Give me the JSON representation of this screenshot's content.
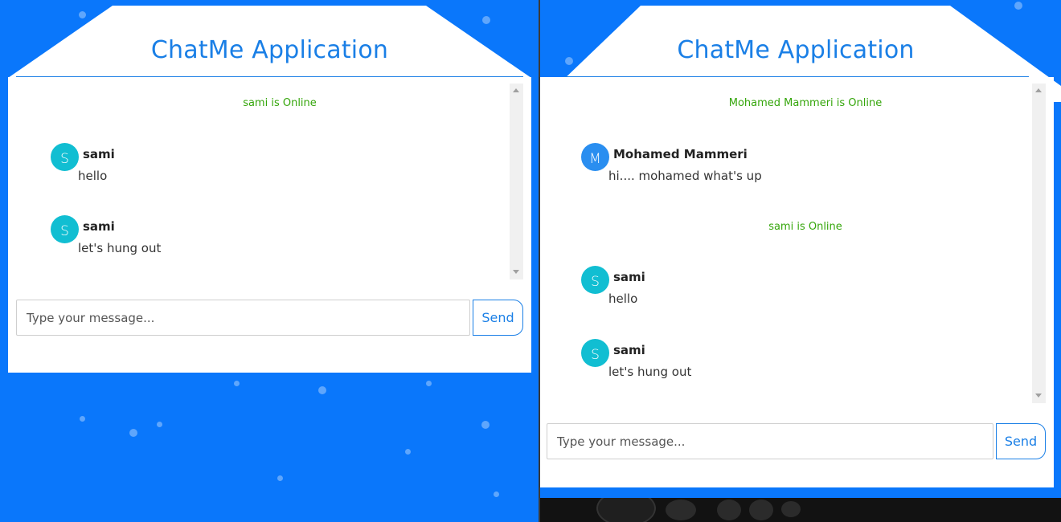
{
  "panes": [
    {
      "title": "ChatMe Application",
      "messages": [
        {
          "type": "status",
          "text": "sami is Online"
        },
        {
          "type": "chat",
          "avatar": "S",
          "avatar_color": "#11bed2",
          "sender": "sami",
          "text": "hello"
        },
        {
          "type": "chat",
          "avatar": "S",
          "avatar_color": "#11bed2",
          "sender": "sami",
          "text": "let's hung out"
        }
      ],
      "input_placeholder": "Type your message...",
      "send_label": "Send"
    },
    {
      "title": "ChatMe Application",
      "messages": [
        {
          "type": "status",
          "text": "Mohamed Mammeri is Online"
        },
        {
          "type": "chat",
          "avatar": "M",
          "avatar_color": "#2a8ef0",
          "sender": "Mohamed Mammeri",
          "text": "hi.... mohamed what's up"
        },
        {
          "type": "status",
          "text": "sami is Online"
        },
        {
          "type": "chat",
          "avatar": "S",
          "avatar_color": "#11bed2",
          "sender": "sami",
          "text": "hello"
        },
        {
          "type": "chat",
          "avatar": "S",
          "avatar_color": "#11bed2",
          "sender": "sami",
          "text": "let's hung out"
        }
      ],
      "input_placeholder": "Type your message...",
      "send_label": "Send"
    }
  ],
  "colors": {
    "background": "#0a77fb",
    "accent": "#1a7fe6",
    "status_green": "#35a60b"
  }
}
